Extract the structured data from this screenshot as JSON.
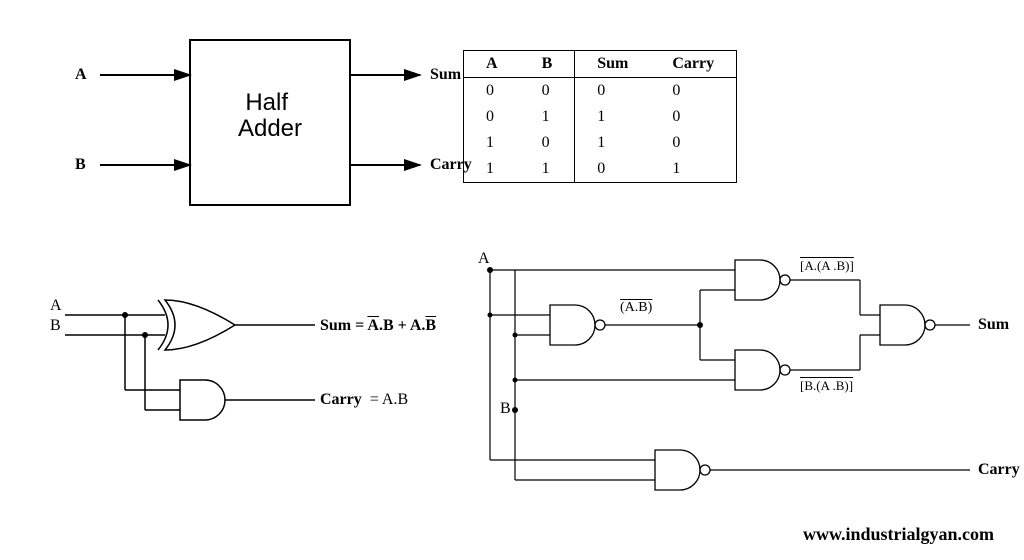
{
  "block": {
    "title_line1": "Half",
    "title_line2": "Adder",
    "input_a": "A",
    "input_b": "B",
    "output_sum": "Sum",
    "output_carry": "Carry"
  },
  "truth_table": {
    "headers": [
      "A",
      "B",
      "Sum",
      "Carry"
    ],
    "rows": [
      [
        "0",
        "0",
        "0",
        "0"
      ],
      [
        "0",
        "1",
        "1",
        "0"
      ],
      [
        "1",
        "0",
        "1",
        "0"
      ],
      [
        "1",
        "1",
        "0",
        "1"
      ]
    ]
  },
  "xor_circuit": {
    "input_a": "A",
    "input_b": "B",
    "sum_label": "Sum =",
    "sum_expr_a": "A",
    "sum_expr_b": ".B + A.",
    "sum_expr_c": "B",
    "carry_label": "Carry",
    "carry_expr": "= A.B"
  },
  "nand_circuit": {
    "input_a": "A",
    "input_b": "B",
    "mid_label": "(A.B)",
    "top_label_open": "[A.",
    "top_label_mid": "(A .B)",
    "top_label_close": "]",
    "bot_label_open": "[B.",
    "bot_label_mid": "(A .B)",
    "bot_label_close": "]",
    "output_sum": "Sum",
    "output_carry": "Carry"
  },
  "watermark": "www.industrialgyan.com"
}
